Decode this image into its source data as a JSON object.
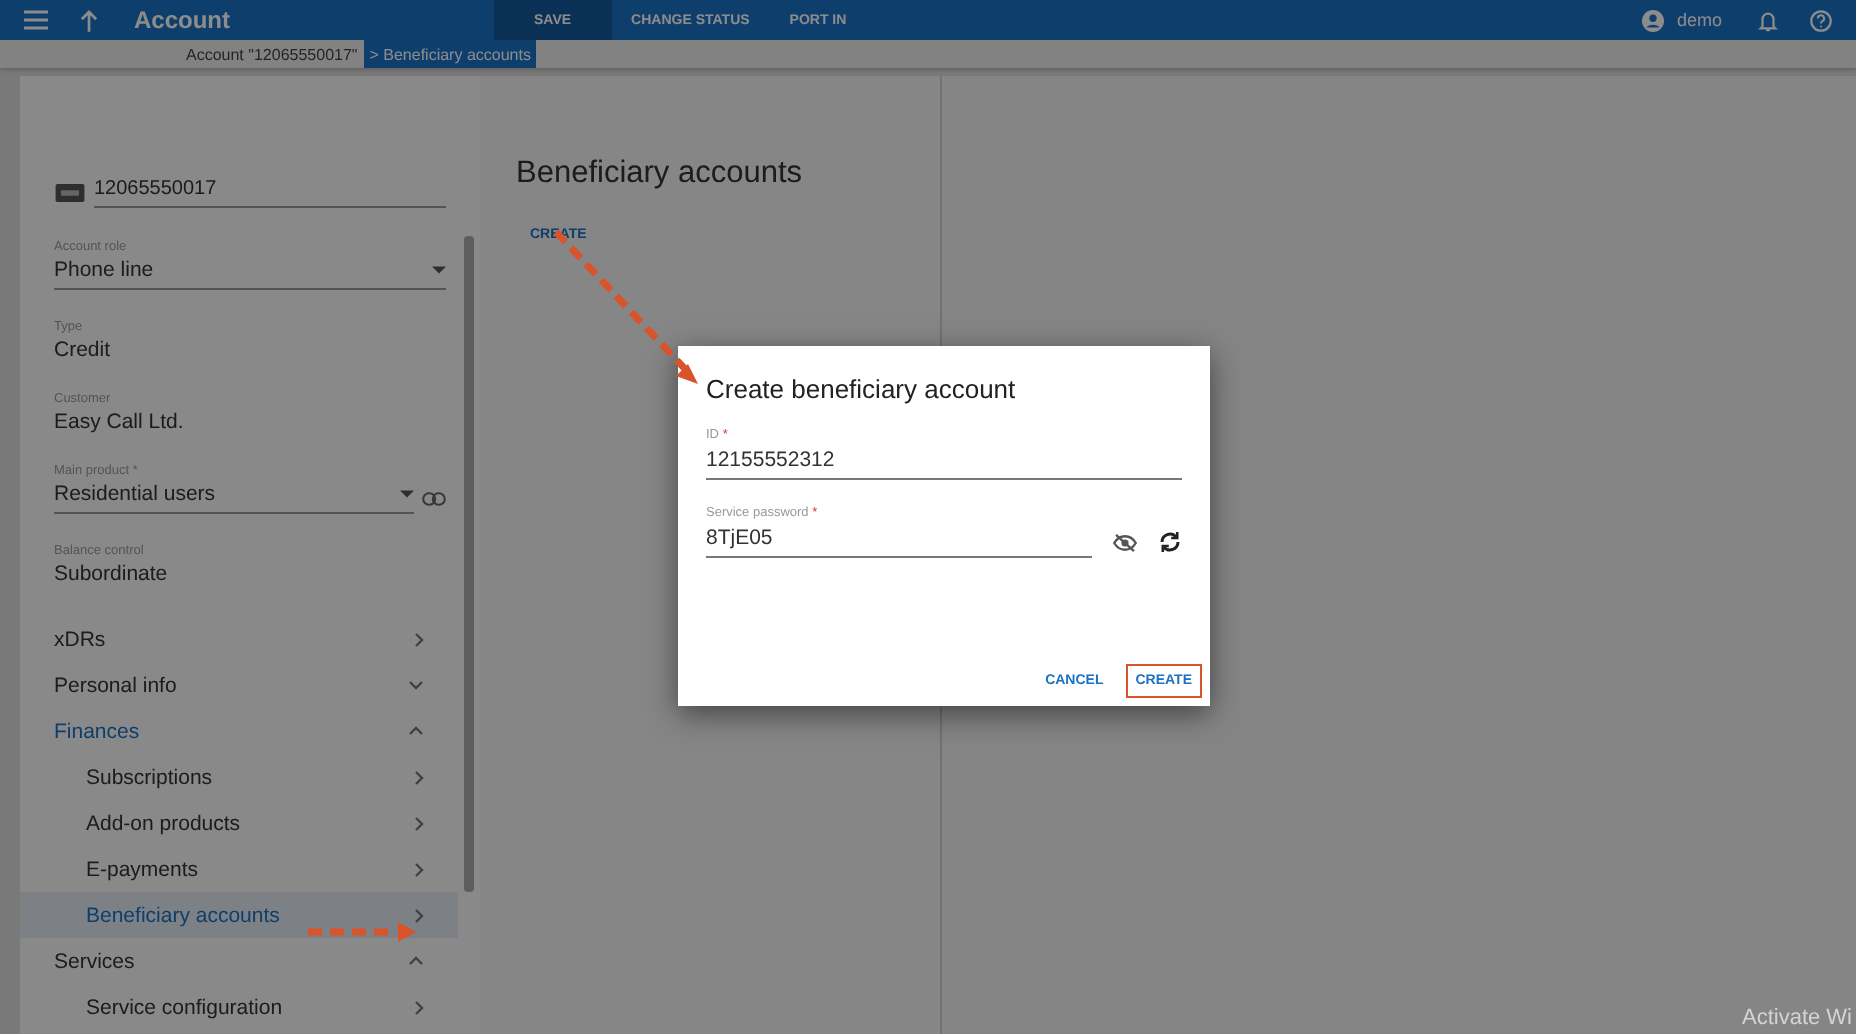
{
  "top_bar": {
    "title": "Account",
    "actions": [
      {
        "label": "SAVE",
        "selected": true
      },
      {
        "label": "CHANGE STATUS",
        "selected": false
      },
      {
        "label": "PORT IN",
        "selected": false
      }
    ],
    "user": "demo"
  },
  "breadcrumbs": [
    {
      "label": "Account \"12065550017\"",
      "selected": false
    },
    {
      "label": "> Beneficiary accounts",
      "selected": true
    }
  ],
  "sidebar": {
    "account_id": "12065550017",
    "fields": [
      {
        "kind": "dropdown",
        "label": "Account role",
        "value": "Phone line"
      },
      {
        "kind": "text",
        "label": "Type",
        "value": "Credit"
      },
      {
        "kind": "text",
        "label": "Customer",
        "value": "Easy Call Ltd."
      },
      {
        "kind": "linked-dropdown",
        "label": "Main product *",
        "value": "Residential users"
      },
      {
        "kind": "text",
        "label": "Balance control",
        "value": "Subordinate"
      }
    ],
    "items": [
      {
        "label": "xDRs",
        "kind": "link",
        "selected": false
      },
      {
        "label": "Personal info",
        "kind": "group",
        "expanded": false,
        "selected": false
      },
      {
        "label": "Finances",
        "kind": "group",
        "expanded": true,
        "selected": true,
        "children": [
          {
            "label": "Subscriptions",
            "selected": false
          },
          {
            "label": "Add-on products",
            "selected": false
          },
          {
            "label": "E-payments",
            "selected": false
          },
          {
            "label": "Beneficiary accounts",
            "selected": true
          }
        ]
      },
      {
        "label": "Services",
        "kind": "group",
        "expanded": true,
        "selected": false,
        "children": [
          {
            "label": "Service configuration",
            "selected": false
          }
        ]
      }
    ]
  },
  "main": {
    "title": "Beneficiary accounts",
    "create_link": "CREATE"
  },
  "dialog": {
    "title": "Create beneficiary account",
    "fields": [
      {
        "kind": "text",
        "label": "ID",
        "required_mark": "*",
        "value": "12155552312"
      },
      {
        "kind": "password",
        "label": "Service password",
        "required_mark": "*",
        "value": "8TjE05"
      }
    ],
    "buttons": [
      {
        "label": "CANCEL",
        "highlighted": false
      },
      {
        "label": "CREATE",
        "highlighted": true
      }
    ]
  },
  "activation_notice": "Activate Wi"
}
